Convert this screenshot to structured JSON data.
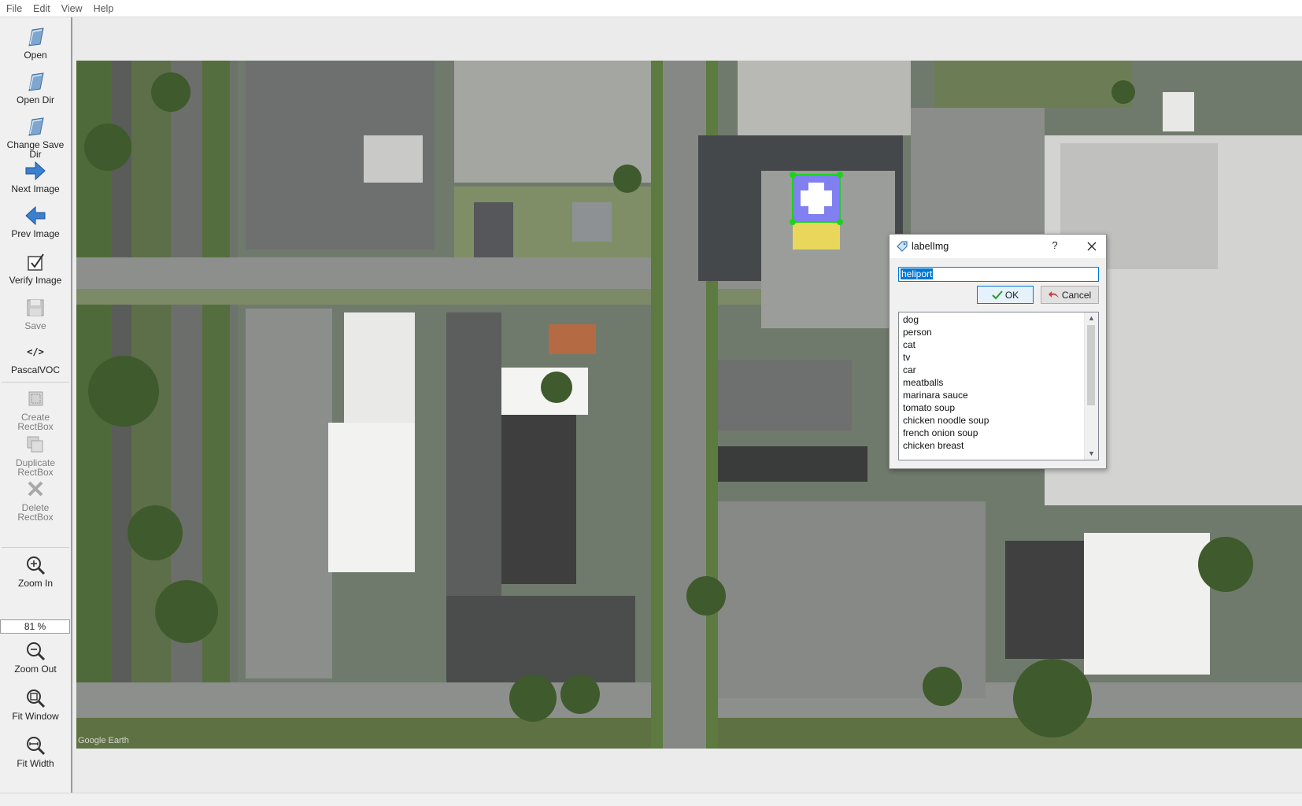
{
  "menubar": {
    "items": [
      "File",
      "Edit",
      "View",
      "Help"
    ]
  },
  "toolbar": {
    "open": "Open",
    "open_dir": "Open Dir",
    "change_save_dir": "Change Save Dir",
    "next_image": "Next Image",
    "prev_image": "Prev Image",
    "verify_image": "Verify Image",
    "save": "Save",
    "format_icon_text": "</>",
    "format": "PascalVOC",
    "create_rectbox": [
      "Create",
      "RectBox"
    ],
    "duplicate_rectbox": [
      "Duplicate",
      "RectBox"
    ],
    "delete_rectbox": [
      "Delete",
      "RectBox"
    ],
    "zoom_in": "Zoom In",
    "zoom_value": "81 %",
    "zoom_out": "Zoom Out",
    "fit_window": "Fit Window",
    "fit_width": "Fit Width"
  },
  "image": {
    "watermark": "Google Earth"
  },
  "dialog": {
    "title": "labelImg",
    "help": "?",
    "input_value": "heliport",
    "ok_label": "OK",
    "cancel_label": "Cancel",
    "labels": [
      "dog",
      "person",
      "cat",
      "tv",
      "car",
      "meatballs",
      "marinara sauce",
      "tomato soup",
      "chicken noodle soup",
      "french onion soup",
      "chicken breast"
    ]
  },
  "colors": {
    "selection": "#0078d7",
    "bbox_handle": "#1fd11f",
    "bbox_fill": "#7b7bff"
  }
}
